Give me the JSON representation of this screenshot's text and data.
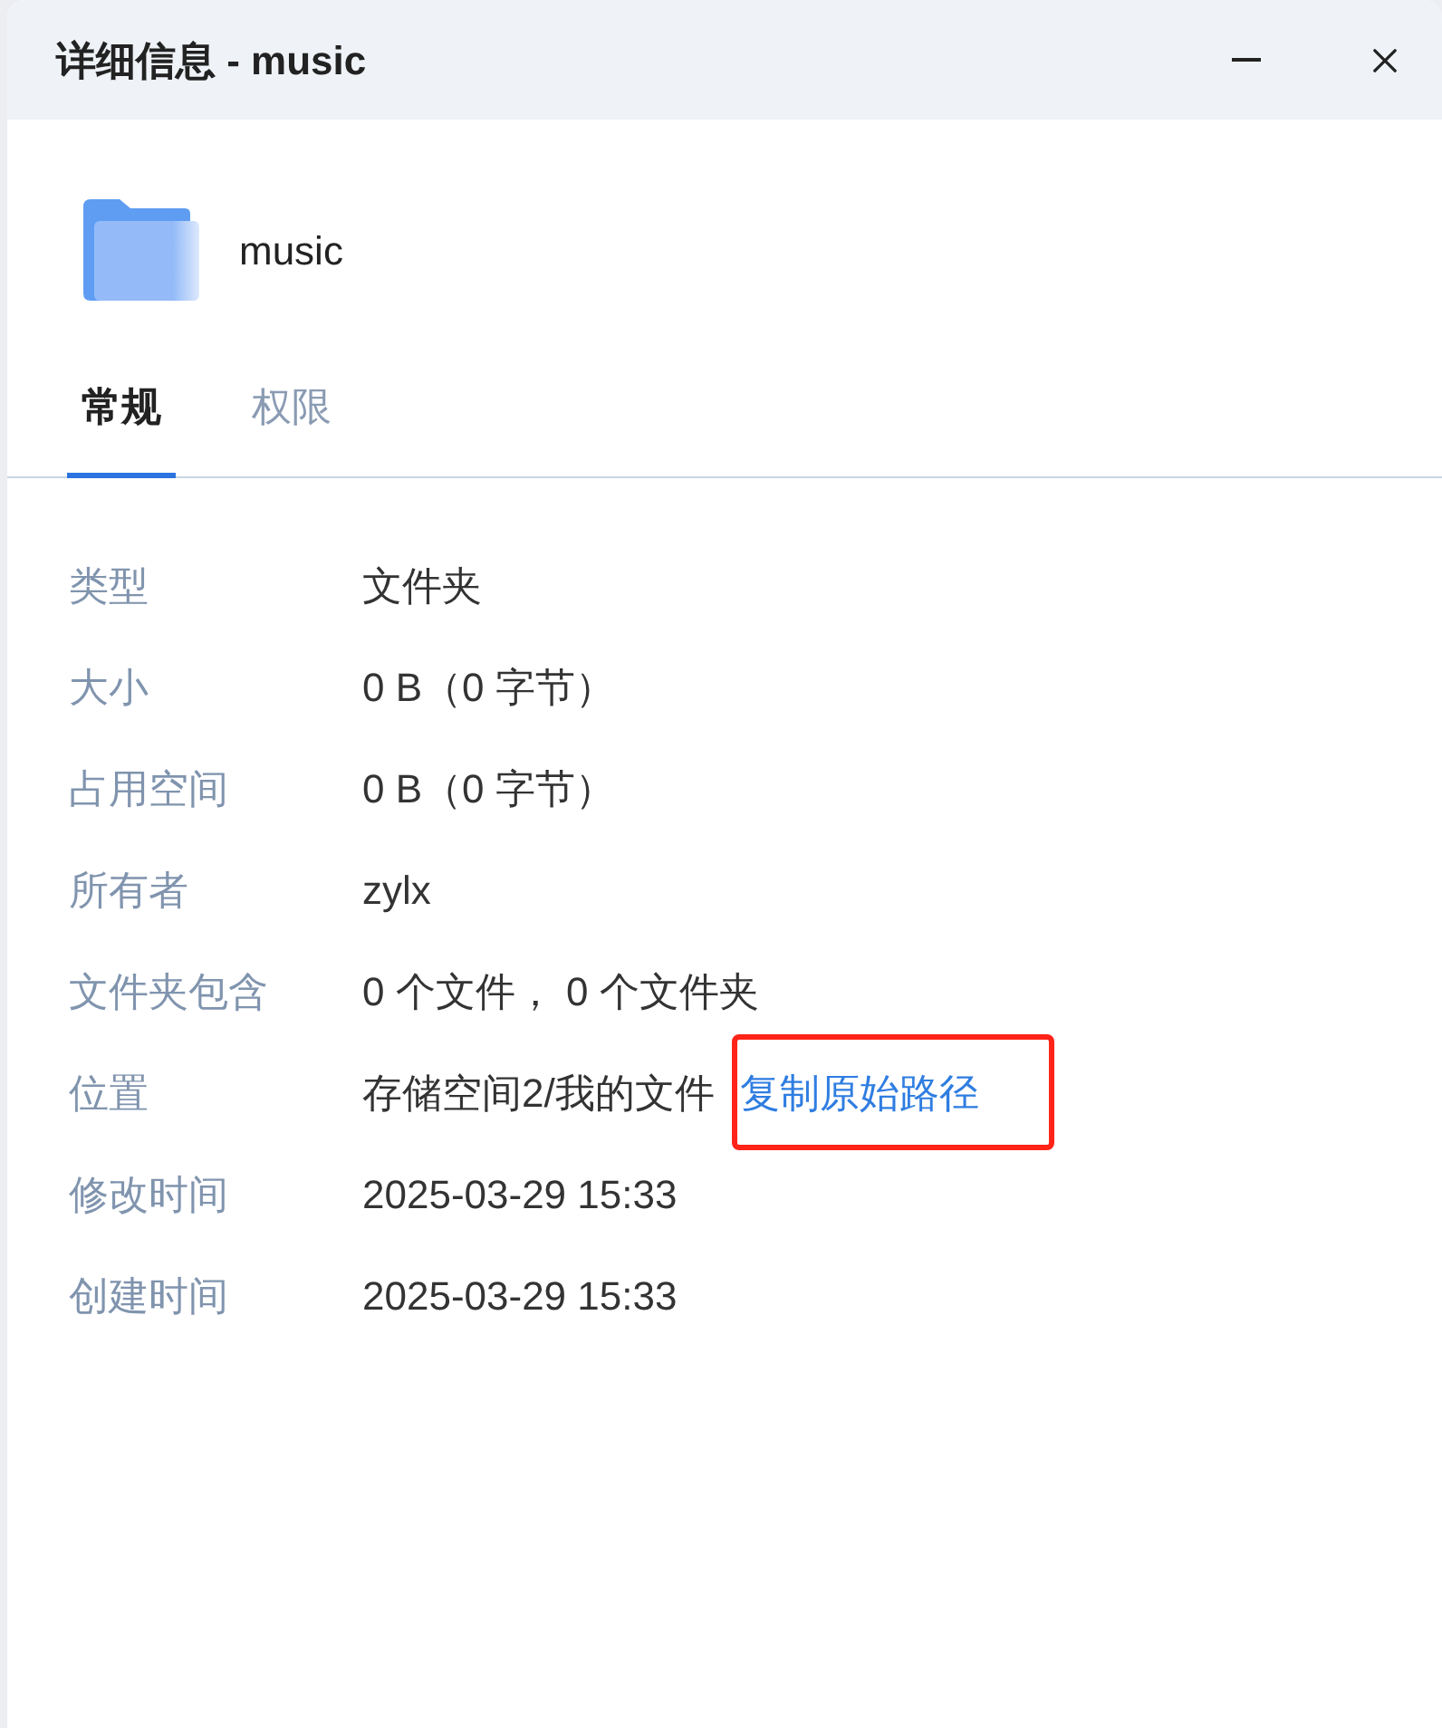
{
  "window": {
    "title": "详细信息 - music"
  },
  "item": {
    "name": "music"
  },
  "tabs": [
    {
      "label": "常规",
      "selected": true
    },
    {
      "label": "权限",
      "selected": false
    }
  ],
  "properties": [
    {
      "label": "类型",
      "value": "文件夹"
    },
    {
      "label": "大小",
      "value": "0 B（0 字节）"
    },
    {
      "label": "占用空间",
      "value": "0 B（0 字节）"
    },
    {
      "label": "所有者",
      "value": "zylx"
    },
    {
      "label": "文件夹包含",
      "value": "0 个文件， 0 个文件夹"
    },
    {
      "label": "位置",
      "value": "存储空间2/我的文件",
      "link": {
        "text": "复制原始路径",
        "highlighted": true
      }
    },
    {
      "label": "修改时间",
      "value": "2025-03-29 15:33"
    },
    {
      "label": "创建时间",
      "value": "2025-03-29 15:33"
    }
  ]
}
